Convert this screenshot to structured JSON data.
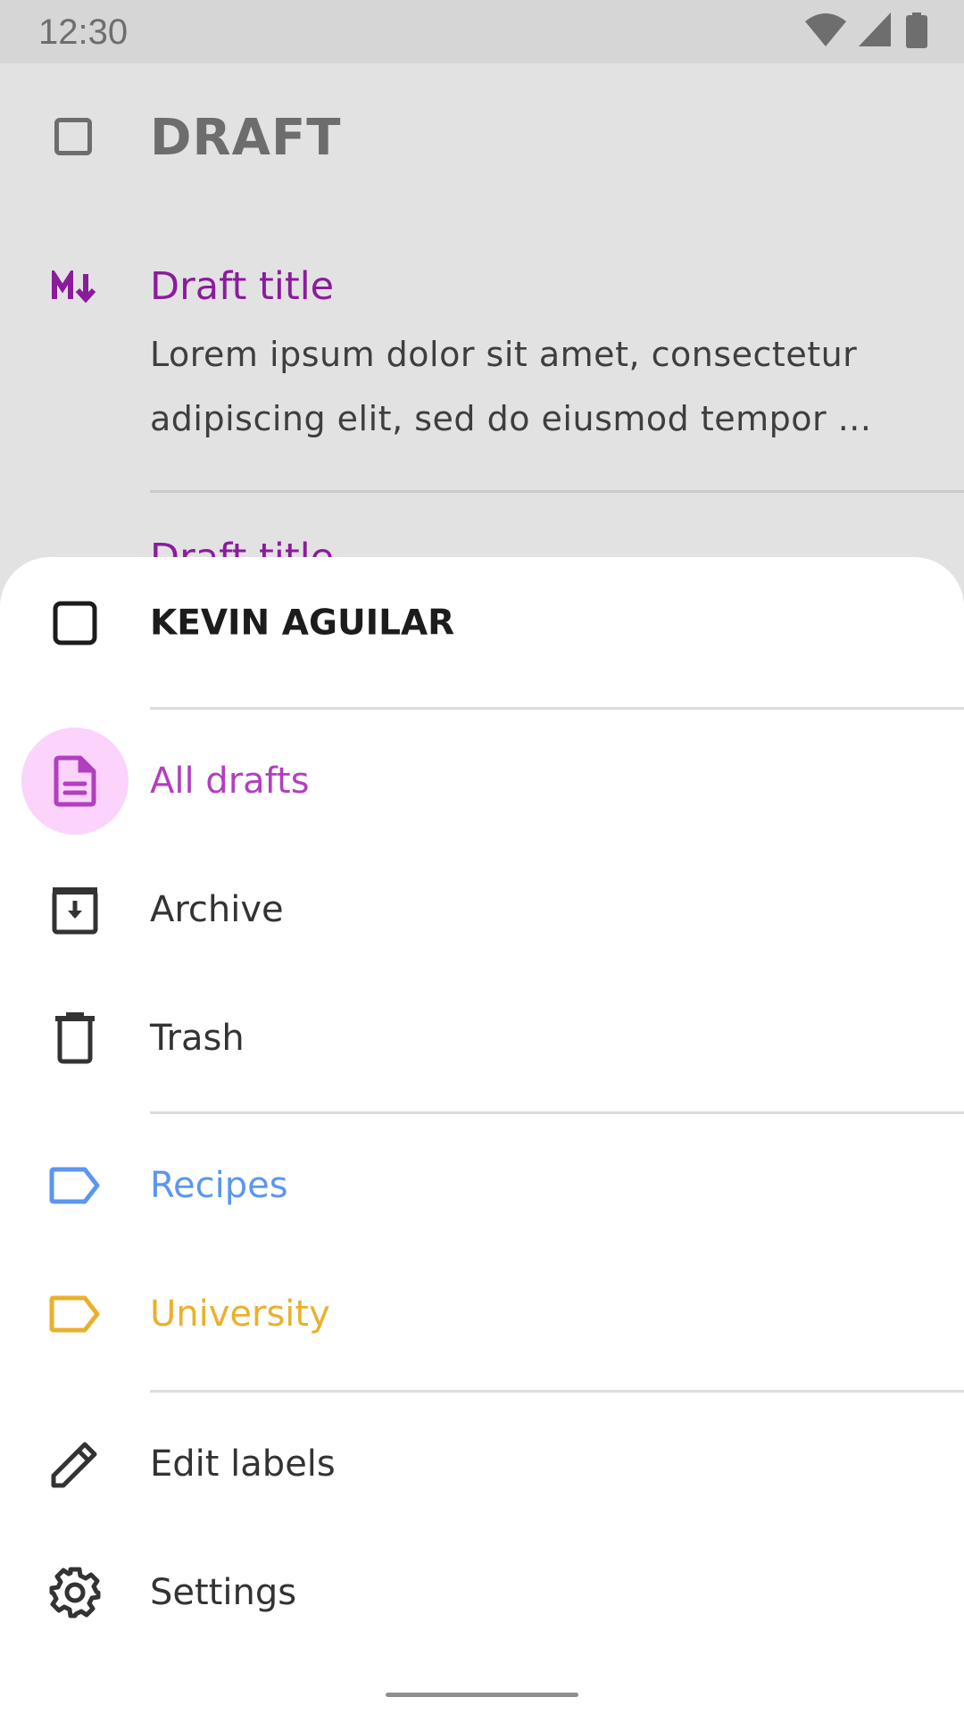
{
  "status_bar": {
    "time": "12:30",
    "icons": [
      "wifi-icon",
      "cellular-signal-icon",
      "battery-icon"
    ]
  },
  "background": {
    "header_title": "DRAFT",
    "draft_item": {
      "title": "Draft title",
      "body": "Lorem ipsum dolor sit amet, consectetur adipiscing elit, sed do eiusmod tempor ...",
      "icon": "markdown-icon"
    },
    "next_item_title": "Draft title"
  },
  "drawer": {
    "account_name": "KEVIN AGUILAR",
    "items": [
      {
        "label": "All drafts",
        "icon": "document-icon",
        "active": true,
        "color": "#b23fbf"
      },
      {
        "label": "Archive",
        "icon": "archive-icon",
        "color": "#333333"
      },
      {
        "label": "Trash",
        "icon": "trash-icon",
        "color": "#333333"
      }
    ],
    "labels": [
      {
        "label": "Recipes",
        "icon": "label-icon",
        "color": "#5b96ef"
      },
      {
        "label": "University",
        "icon": "label-icon",
        "color": "#eab02d"
      }
    ],
    "actions": [
      {
        "label": "Edit labels",
        "icon": "pencil-icon"
      },
      {
        "label": "Settings",
        "icon": "gear-icon"
      }
    ]
  },
  "colors": {
    "accent": "#8a1c9c",
    "active_highlight": "#fbd3fb",
    "active_text": "#b23fbf",
    "scrim": "#e2e2e2"
  }
}
